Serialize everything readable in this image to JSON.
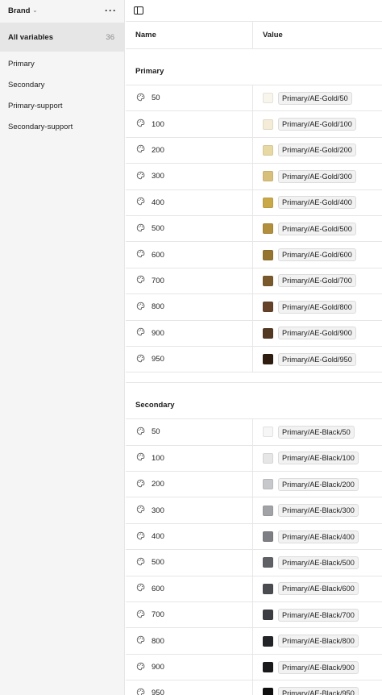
{
  "sidebar": {
    "collection": "Brand",
    "all_label": "All variables",
    "all_count": "36",
    "groups": [
      "Primary",
      "Secondary",
      "Primary-support",
      "Secondary-support"
    ]
  },
  "table": {
    "col_name": "Name",
    "col_value": "Value",
    "groups": [
      {
        "title": "Primary",
        "rows": [
          {
            "name": "50",
            "value": "Primary/AE-Gold/50",
            "color": "#f8f6ec"
          },
          {
            "name": "100",
            "value": "Primary/AE-Gold/100",
            "color": "#f4ecd6"
          },
          {
            "name": "200",
            "value": "Primary/AE-Gold/200",
            "color": "#e8d8a4"
          },
          {
            "name": "300",
            "value": "Primary/AE-Gold/300",
            "color": "#d8c07a"
          },
          {
            "name": "400",
            "value": "Primary/AE-Gold/400",
            "color": "#c9a848"
          },
          {
            "name": "500",
            "value": "Primary/AE-Gold/500",
            "color": "#b18f3c"
          },
          {
            "name": "600",
            "value": "Primary/AE-Gold/600",
            "color": "#957430"
          },
          {
            "name": "700",
            "value": "Primary/AE-Gold/700",
            "color": "#7a5a2c"
          },
          {
            "name": "800",
            "value": "Primary/AE-Gold/800",
            "color": "#654228"
          },
          {
            "name": "900",
            "value": "Primary/AE-Gold/900",
            "color": "#533822"
          },
          {
            "name": "950",
            "value": "Primary/AE-Gold/950",
            "color": "#2e1d10"
          }
        ]
      },
      {
        "title": "Secondary",
        "rows": [
          {
            "name": "50",
            "value": "Primary/AE-Black/50",
            "color": "#f6f6f6"
          },
          {
            "name": "100",
            "value": "Primary/AE-Black/100",
            "color": "#e6e6e6"
          },
          {
            "name": "200",
            "value": "Primary/AE-Black/200",
            "color": "#c7c8cb"
          },
          {
            "name": "300",
            "value": "Primary/AE-Black/300",
            "color": "#a2a3a7"
          },
          {
            "name": "400",
            "value": "Primary/AE-Black/400",
            "color": "#7d7f85"
          },
          {
            "name": "500",
            "value": "Primary/AE-Black/500",
            "color": "#5f6167"
          },
          {
            "name": "600",
            "value": "Primary/AE-Black/600",
            "color": "#4b4c52"
          },
          {
            "name": "700",
            "value": "Primary/AE-Black/700",
            "color": "#3c3d42"
          },
          {
            "name": "800",
            "value": "Primary/AE-Black/800",
            "color": "#232427"
          },
          {
            "name": "900",
            "value": "Primary/AE-Black/900",
            "color": "#1a1a1c"
          },
          {
            "name": "950",
            "value": "Primary/AE-Black/950",
            "color": "#0f0f10"
          }
        ]
      }
    ]
  }
}
